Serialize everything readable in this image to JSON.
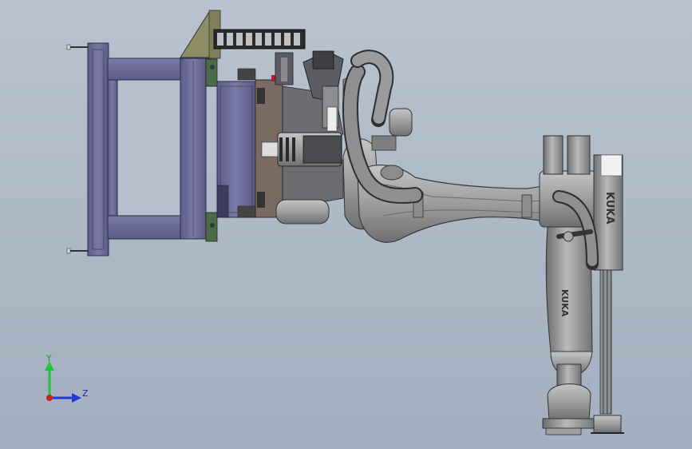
{
  "viewport": {
    "background": "#b2bcc9",
    "model": {
      "brand_text_arm": "KUKA",
      "brand_text_column": "KUKA",
      "fixture_frame_color": "#6f6f9c",
      "robot_color": "#9a9b9c",
      "hose_color": "#8e8f90"
    },
    "triad": {
      "y_label": "Y",
      "z_label": "Z",
      "y_color": "#22c33a",
      "z_color": "#2438d4",
      "origin_color": "#d01f1f"
    }
  }
}
